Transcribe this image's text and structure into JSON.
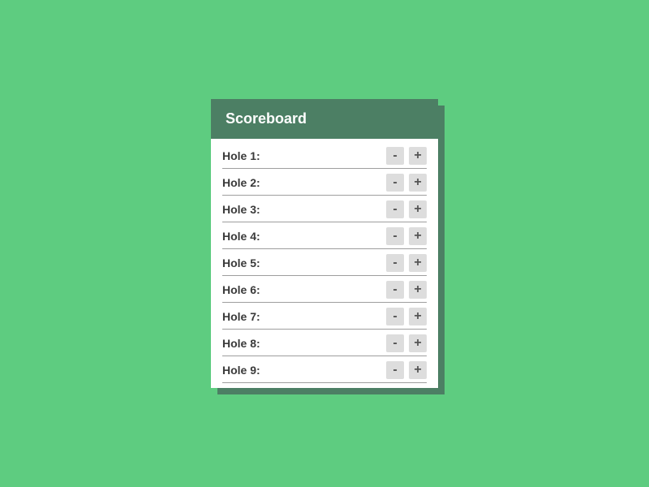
{
  "header": {
    "title": "Scoreboard"
  },
  "buttons": {
    "minus_label": "-",
    "plus_label": "+"
  },
  "holes": [
    {
      "label": "Hole 1:"
    },
    {
      "label": "Hole 2:"
    },
    {
      "label": "Hole 3:"
    },
    {
      "label": "Hole 4:"
    },
    {
      "label": "Hole 5:"
    },
    {
      "label": "Hole 6:"
    },
    {
      "label": "Hole 7:"
    },
    {
      "label": "Hole 8:"
    },
    {
      "label": "Hole 9:"
    }
  ]
}
